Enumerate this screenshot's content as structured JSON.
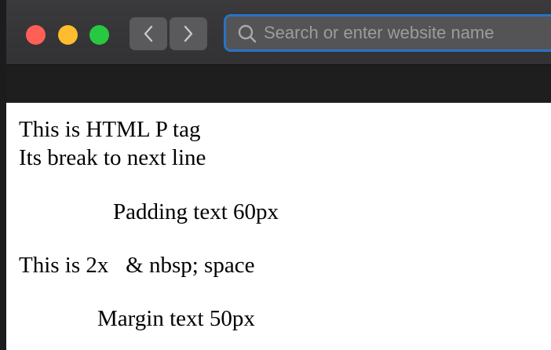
{
  "browser": {
    "search_placeholder": "Search or enter website name",
    "buttons": {
      "back_icon": "chevron-left-icon",
      "forward_icon": "chevron-right-icon"
    },
    "traffic_lights": {
      "close_color": "#ff5f57",
      "minimize_color": "#febc2e",
      "zoom_color": "#28c840"
    },
    "accent_color": "#2a73c4"
  },
  "page": {
    "line1": "This is HTML P tag",
    "line2": "Its break to next line",
    "padding_text": "Padding text 60px",
    "nbsp_text": "This is 2x   & nbsp; space",
    "margin_text": "Margin text 50px"
  }
}
